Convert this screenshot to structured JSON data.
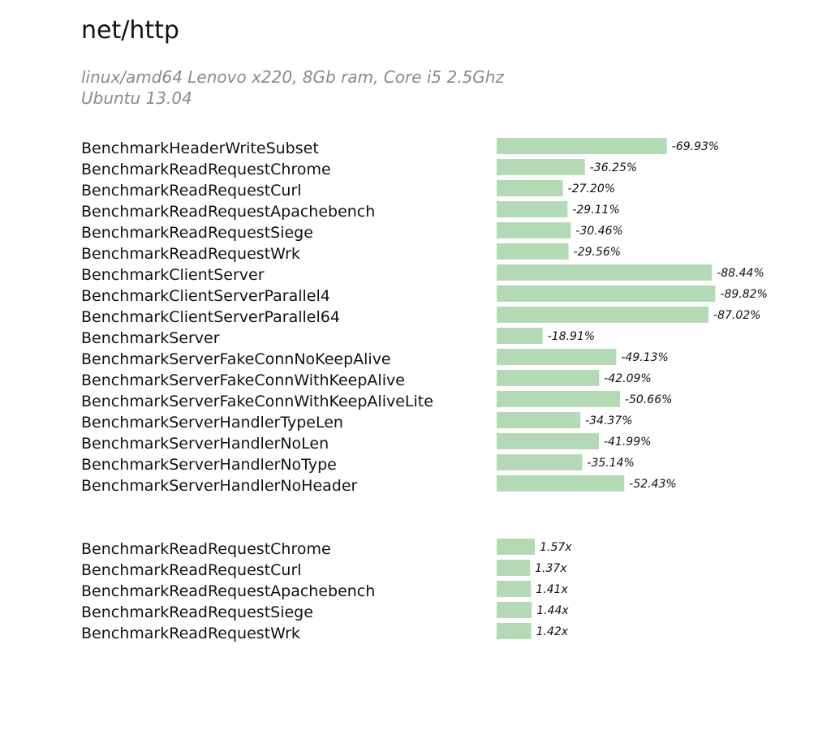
{
  "title": "net/http",
  "subtitle": {
    "line1": "linux/amd64 Lenovo x220, 8Gb ram, Core i5 2.5Ghz",
    "line2": "Ubuntu 13.04"
  },
  "colors": {
    "bar": "#b3dab5",
    "text": "#111111",
    "subtitle": "#8a8a8a"
  },
  "chart_data": [
    {
      "type": "bar",
      "orientation": "horizontal",
      "categories": [
        "BenchmarkHeaderWriteSubset",
        "BenchmarkReadRequestChrome",
        "BenchmarkReadRequestCurl",
        "BenchmarkReadRequestApachebench",
        "BenchmarkReadRequestSiege",
        "BenchmarkReadRequestWrk",
        "BenchmarkClientServer",
        "BenchmarkClientServerParallel4",
        "BenchmarkClientServerParallel64",
        "BenchmarkServer",
        "BenchmarkServerFakeConnNoKeepAlive",
        "BenchmarkServerFakeConnWithKeepAlive",
        "BenchmarkServerFakeConnWithKeepAliveLite",
        "BenchmarkServerHandlerTypeLen",
        "BenchmarkServerHandlerNoLen",
        "BenchmarkServerHandlerNoType",
        "BenchmarkServerHandlerNoHeader"
      ],
      "values": [
        -69.93,
        -36.25,
        -27.2,
        -29.11,
        -30.46,
        -29.56,
        -88.44,
        -89.82,
        -87.02,
        -18.91,
        -49.13,
        -42.09,
        -50.66,
        -34.37,
        -41.99,
        -35.14,
        -52.43
      ],
      "labels": [
        "-69.93%",
        "-36.25%",
        "-27.20%",
        "-29.11%",
        "-30.46%",
        "-29.56%",
        "-88.44%",
        "-89.82%",
        "-87.02%",
        "-18.91%",
        "-49.13%",
        "-42.09%",
        "-50.66%",
        "-34.37%",
        "-41.99%",
        "-35.14%",
        "-52.43%"
      ],
      "unit": "%",
      "grid": false
    },
    {
      "type": "bar",
      "orientation": "horizontal",
      "categories": [
        "BenchmarkReadRequestChrome",
        "BenchmarkReadRequestCurl",
        "BenchmarkReadRequestApachebench",
        "BenchmarkReadRequestSiege",
        "BenchmarkReadRequestWrk"
      ],
      "values": [
        1.57,
        1.37,
        1.41,
        1.44,
        1.42
      ],
      "labels": [
        "1.57x",
        "1.37x",
        "1.41x",
        "1.44x",
        "1.42x"
      ],
      "unit": "x",
      "grid": false
    }
  ]
}
